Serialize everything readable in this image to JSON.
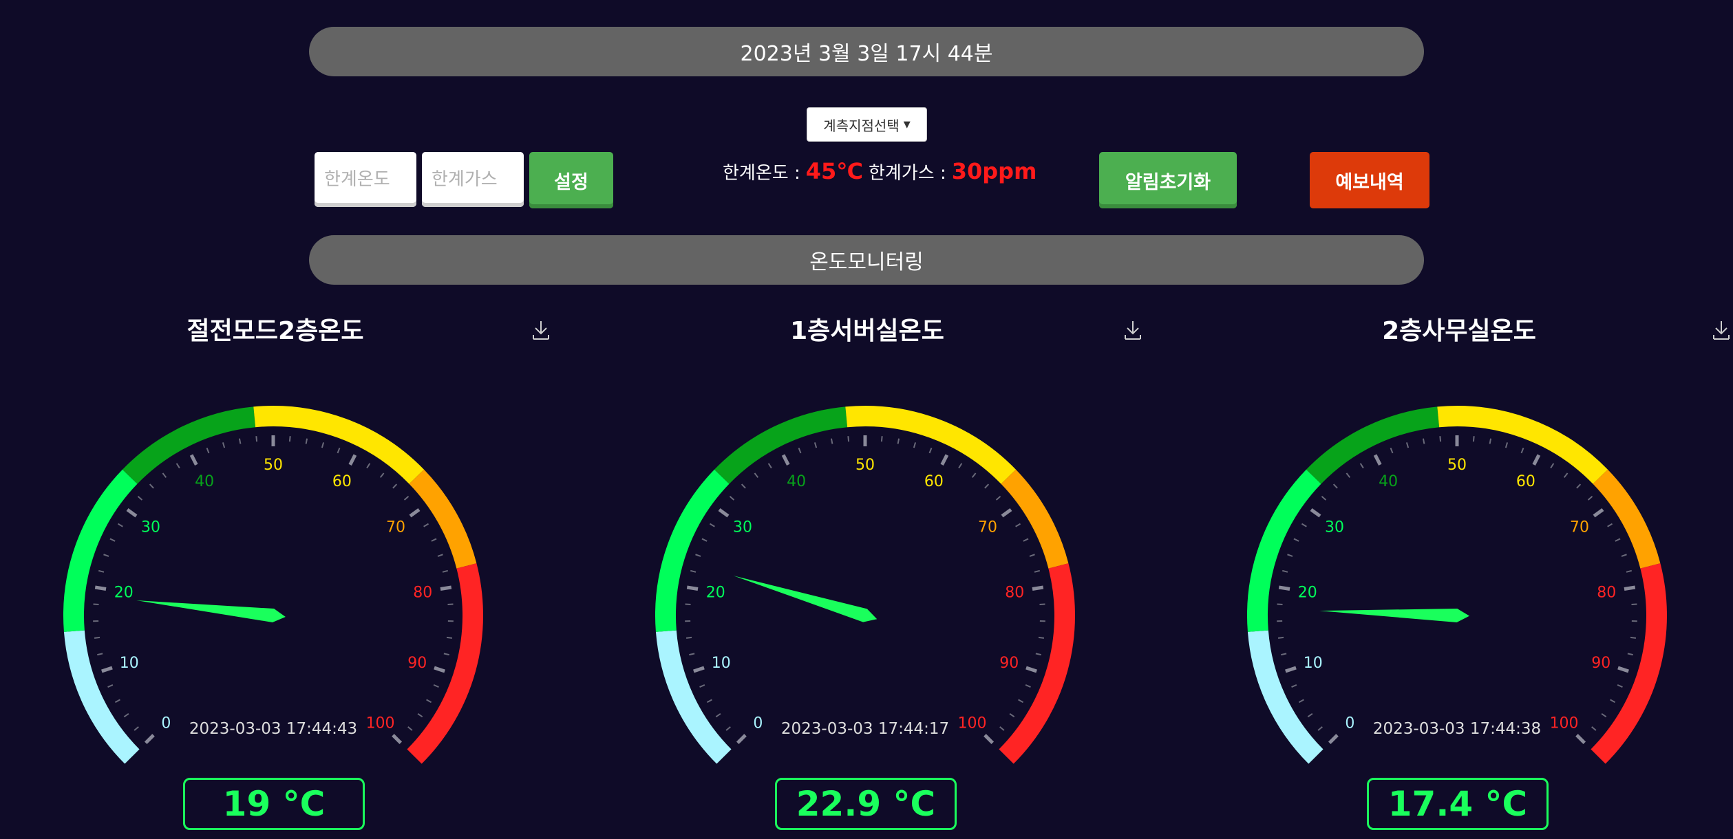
{
  "header": {
    "datetime": "2023년 3월 3일 17시 44분"
  },
  "controls": {
    "dropdown_label": "계측지점선택",
    "limit_temp_placeholder": "한계온도",
    "limit_gas_placeholder": "한계가스",
    "set_label": "설정",
    "limit_temp_label": "한계온도 :",
    "limit_temp_value": "45℃",
    "limit_gas_label": "한계가스 :",
    "limit_gas_value": "30ppm",
    "reset_alarm_label": "알림초기화",
    "forecast_label": "예보내역"
  },
  "section": {
    "title": "온도모니터링"
  },
  "colors": {
    "background": "#0f0b28",
    "bar": "#646464",
    "band_light_blue": "#aaf4ff",
    "band_light_green": "#00ff5a",
    "band_dark_green": "#07a31a",
    "band_yellow": "#ffe600",
    "band_orange": "#ffa200",
    "band_red": "#ff2424",
    "needle": "#1aff5c",
    "forecast": "#dd3a0a",
    "button_green": "#4caf50"
  },
  "gauge_scale": {
    "min": 0,
    "max": 100,
    "labels": [
      "0",
      "10",
      "20",
      "30",
      "40",
      "50",
      "60",
      "70",
      "80",
      "90",
      "100"
    ],
    "bands": [
      {
        "from": 0,
        "to": 15,
        "color": "#aaf4ff"
      },
      {
        "from": 15,
        "to": 33,
        "color": "#00ff5a"
      },
      {
        "from": 33,
        "to": 48,
        "color": "#07a31a"
      },
      {
        "from": 48,
        "to": 67,
        "color": "#ffe600"
      },
      {
        "from": 67,
        "to": 78,
        "color": "#ffa200"
      },
      {
        "from": 78,
        "to": 100,
        "color": "#ff2424"
      }
    ]
  },
  "gauges": [
    {
      "title": "절전모드2층온도",
      "timestamp": "2023-03-03 17:44:43",
      "value": 19,
      "display": "19 °C"
    },
    {
      "title": "1층서버실온도",
      "timestamp": "2023-03-03 17:44:17",
      "value": 22.9,
      "display": "22.9 °C"
    },
    {
      "title": "2층사무실온도",
      "timestamp": "2023-03-03 17:44:38",
      "value": 17.4,
      "display": "17.4 °C"
    }
  ]
}
